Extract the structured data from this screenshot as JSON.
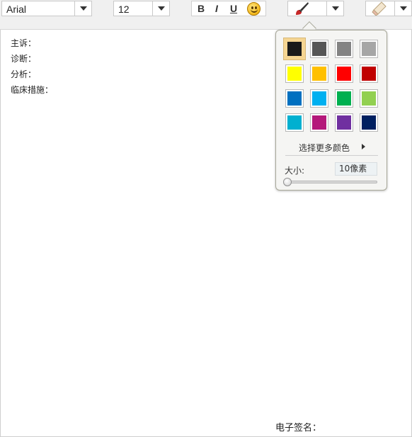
{
  "toolbar": {
    "font_family": "Arial",
    "font_size": "12",
    "bold_label": "B",
    "italic_label": "I",
    "underline_label": "U",
    "emoji_icon": "smiley-emoji-icon",
    "brush_icon": "paintbrush-icon",
    "eraser_icon": "eraser-icon"
  },
  "document": {
    "fields": [
      "主诉：",
      "诊断：",
      "分析：",
      "临床措施："
    ],
    "signature_label": "电子签名："
  },
  "color_popup": {
    "colors": [
      "#1a1a1a",
      "#565656",
      "#838383",
      "#a6a6a6",
      "#ffff00",
      "#ffc000",
      "#ff0000",
      "#c00000",
      "#0070c0",
      "#00b0f0",
      "#00b050",
      "#92d050",
      "#00b0d0",
      "#b4187a",
      "#7030a0",
      "#002060"
    ],
    "selected_index": 0,
    "more_colors_label": "选择更多颜色",
    "size_label": "大小:",
    "size_value": "10像素",
    "size_slider_fraction": 0.0
  }
}
